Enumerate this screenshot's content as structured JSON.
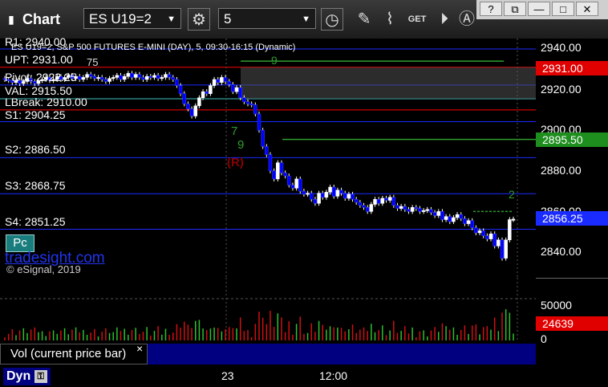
{
  "app_title": "Chart",
  "symbol": "ES U19=2",
  "interval": "5",
  "chart_title": "ES U19=2, S&P 500 FUTURES E-MINI (DAY), 5, 09:30-16:15 (Dynamic)",
  "window_buttons": [
    "?",
    "⧉",
    "—",
    "□",
    "✕"
  ],
  "levels": {
    "r1": "R1: 2940.00",
    "upt": "UPT: 2931.00",
    "pivot": "Pivot: 2922.25",
    "val": "VAL: 2915.50",
    "lbreak": "LBreak: 2910.00",
    "s1": "S1: 2904.25",
    "s2": "S2: 2886.50",
    "s3": "S3: 2868.75",
    "s4": "S4: 2851.25"
  },
  "badge": "Pc",
  "watermark": "tradesight.com",
  "copyright": "© eSignal, 2019",
  "axis_ticks": [
    "2940.00",
    "2920.00",
    "2900.00",
    "2880.00",
    "2860.00",
    "2840.00"
  ],
  "price_flags": {
    "upt": "2931.00",
    "green": "2895.50",
    "last": "2856.25"
  },
  "vol_ticks": [
    "50000",
    "0"
  ],
  "vol_flag": "24639",
  "vol_label": "Vol (current price bar)",
  "vol_close": "×",
  "time_labels": [
    "23",
    "12:00"
  ],
  "dyn_label": "Dyn",
  "markers": {
    "r": "(R)",
    "n75": "75",
    "n9a": "9",
    "n2": "2",
    "n7": "7",
    "n9b": "9"
  },
  "colors": {
    "up_candle": "#ffffff",
    "down_candle": "#0000ff",
    "level_line": "#1a2bff",
    "pivot_line": "#ff0000",
    "green_line": "#2e9e2e",
    "flag_red": "#e00000",
    "flag_green": "#1e8e1e",
    "flag_blue": "#1a2bff"
  },
  "chart_data": {
    "type": "candlestick",
    "y_range": [
      2830,
      2950
    ],
    "closes": [
      2925.0,
      2924.5,
      2923.5,
      2924.5,
      2923.0,
      2924.0,
      2925.5,
      2924.0,
      2923.0,
      2924.5,
      2925.0,
      2926.0,
      2924.5,
      2925.0,
      2926.5,
      2925.0,
      2926.0,
      2927.0,
      2925.5,
      2926.5,
      2925.0,
      2926.0,
      2927.5,
      2926.5,
      2925.5,
      2926.0,
      2925.0,
      2924.0,
      2925.5,
      2926.0,
      2927.0,
      2925.0,
      2926.5,
      2928.0,
      2926.0,
      2927.5,
      2926.0,
      2925.0,
      2926.5,
      2926.0,
      2927.0,
      2925.5,
      2926.0,
      2927.5,
      2926.0,
      2925.0,
      2922.0,
      2918.0,
      2913.0,
      2910.5,
      2907.0,
      2912.0,
      2916.0,
      2919.0,
      2918.0,
      2922.0,
      2925.0,
      2923.5,
      2926.0,
      2924.0,
      2922.5,
      2919.0,
      2921.0,
      2916.0,
      2914.0,
      2913.0,
      2912.5,
      2908.0,
      2900.0,
      2892.0,
      2888.0,
      2880.0,
      2876.0,
      2884.0,
      2879.0,
      2877.5,
      2873.0,
      2871.5,
      2876.0,
      2870.0,
      2868.5,
      2869.0,
      2866.0,
      2864.0,
      2869.0,
      2867.0,
      2869.5,
      2872.0,
      2867.5,
      2870.5,
      2869.0,
      2866.5,
      2868.5,
      2866.0,
      2864.5,
      2863.0,
      2862.0,
      2860.0,
      2863.5,
      2866.0,
      2864.0,
      2866.5,
      2865.5,
      2867.0,
      2863.0,
      2861.5,
      2862.5,
      2861.0,
      2860.0,
      2862.0,
      2861.5,
      2860.0,
      2860.5,
      2861.0,
      2859.5,
      2858.0,
      2860.0,
      2856.0,
      2857.5,
      2855.0,
      2857.0,
      2858.5,
      2856.5,
      2854.0,
      2855.5,
      2852.0,
      2849.5,
      2850.5,
      2848.0,
      2846.5,
      2849.0,
      2843.0,
      2846.0,
      2837.0,
      2846.0,
      2856.0,
      2856.25
    ],
    "volume_max": 62000
  }
}
